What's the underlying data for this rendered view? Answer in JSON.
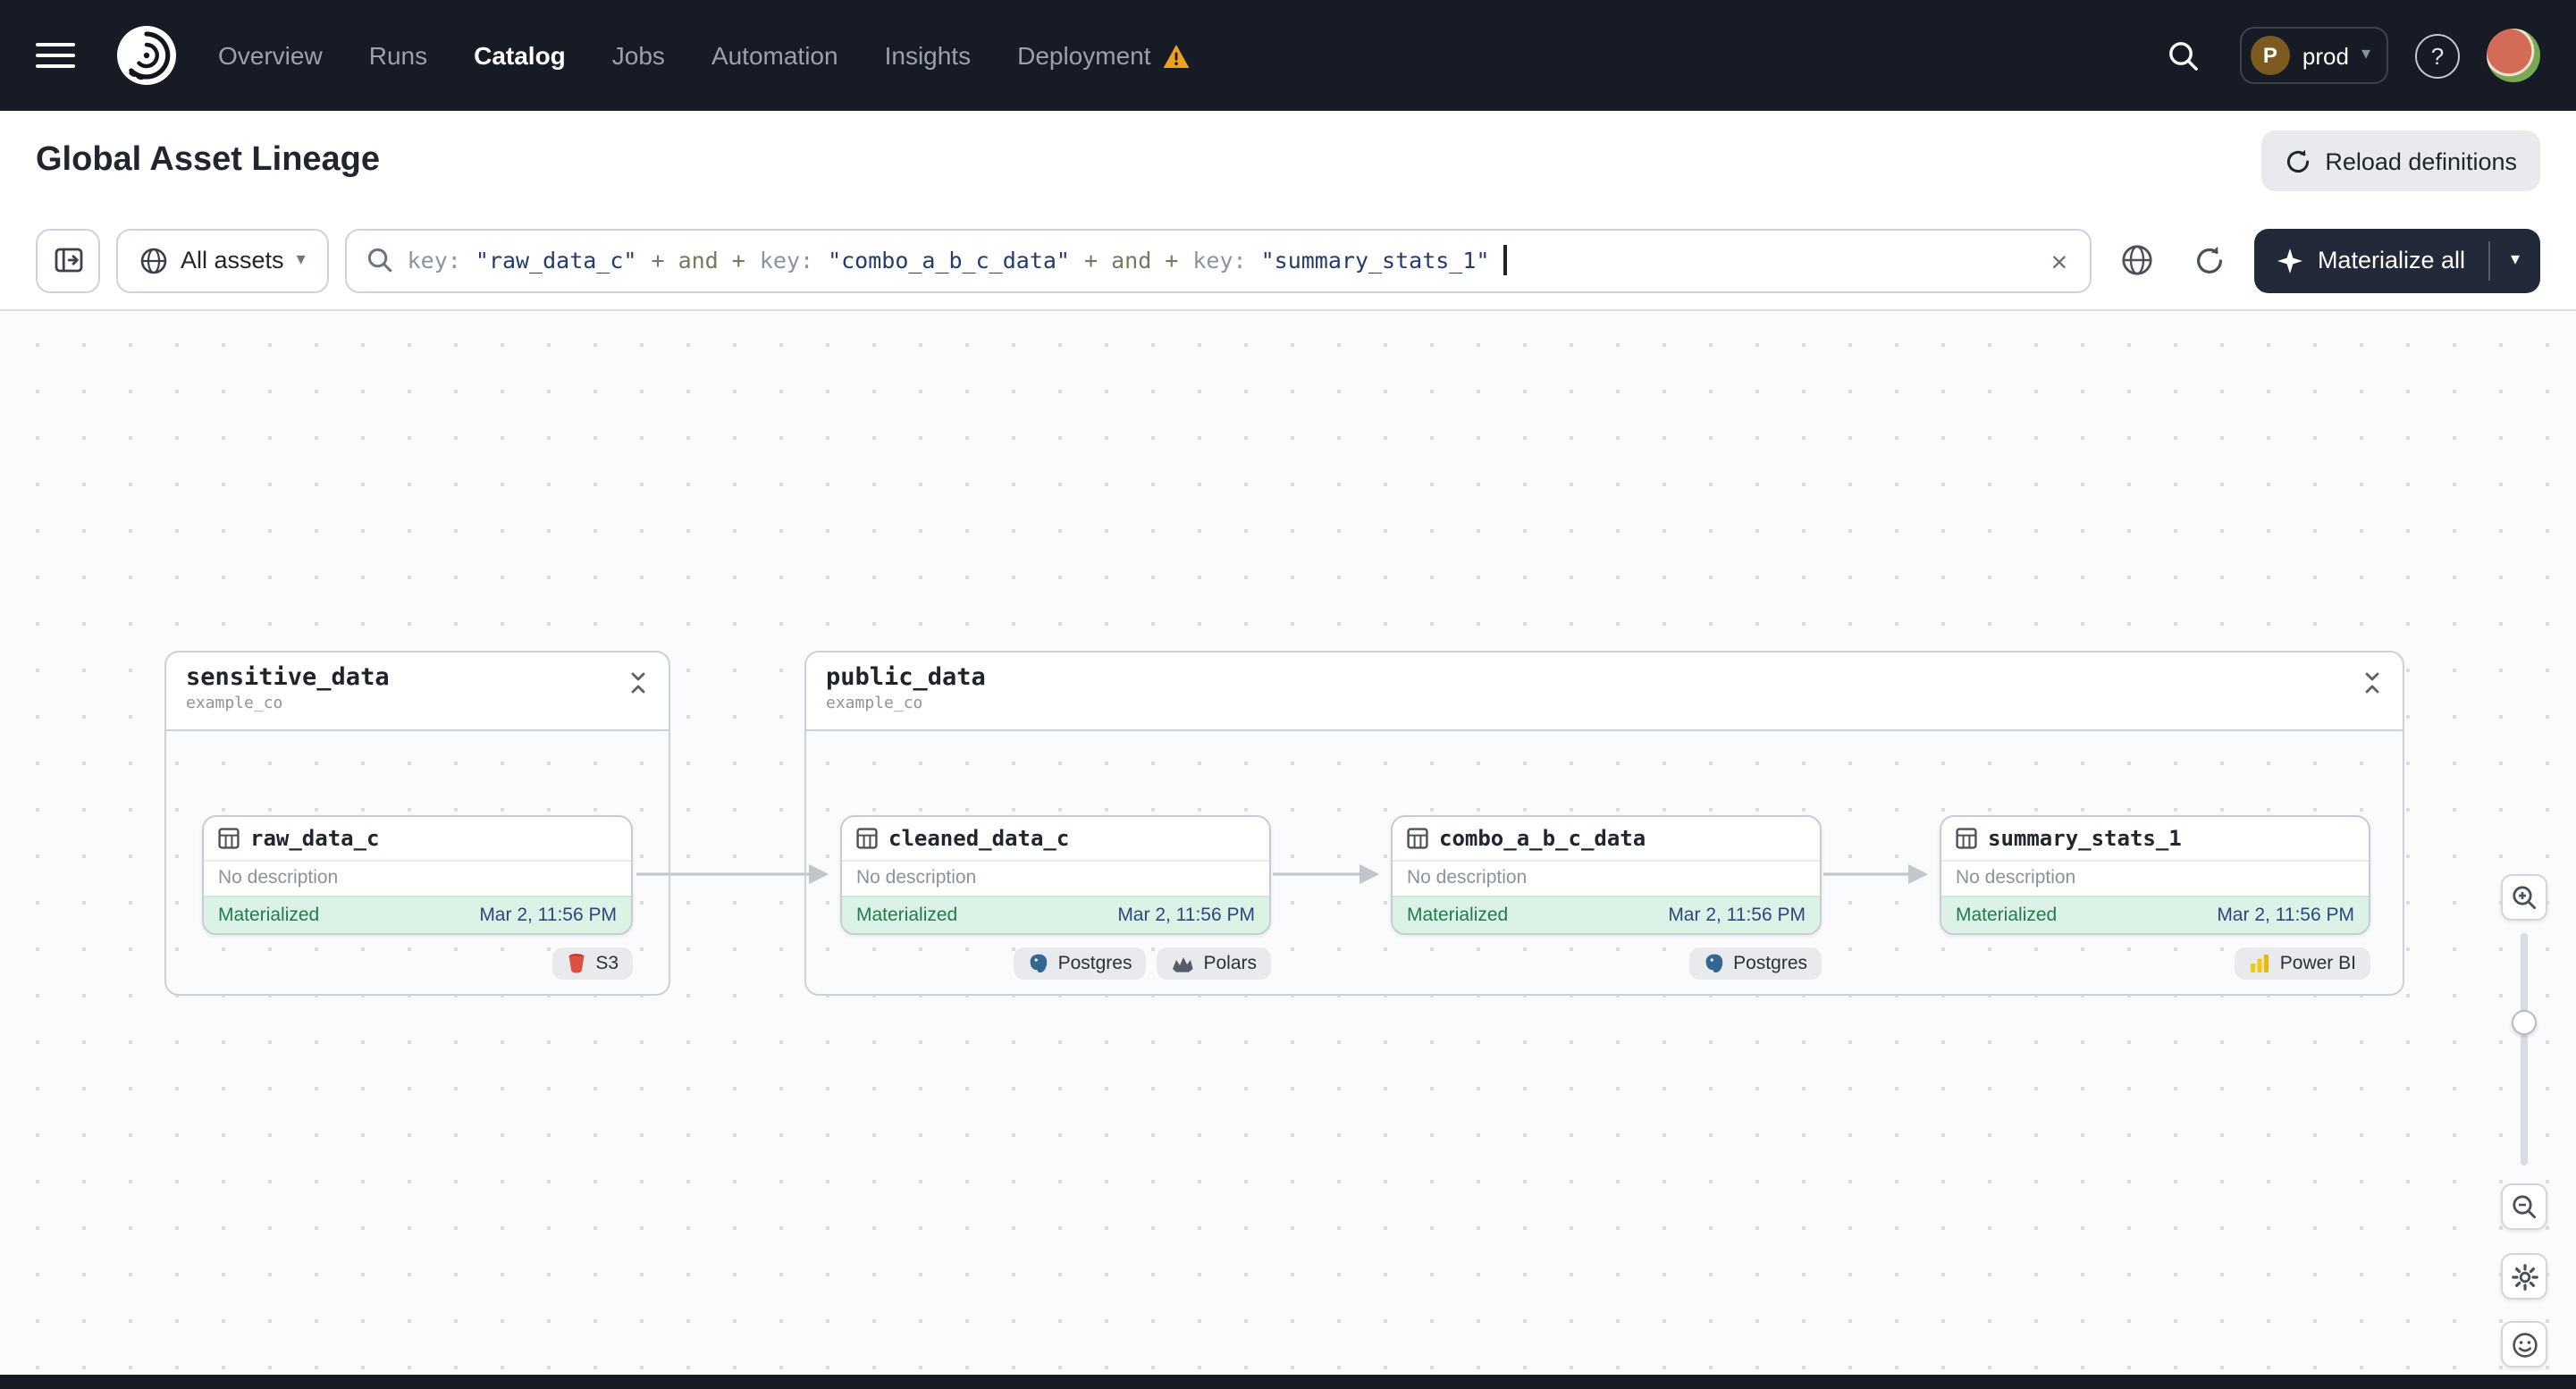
{
  "nav": {
    "items": [
      {
        "label": "Overview"
      },
      {
        "label": "Runs"
      },
      {
        "label": "Catalog"
      },
      {
        "label": "Jobs"
      },
      {
        "label": "Automation"
      },
      {
        "label": "Insights"
      },
      {
        "label": "Deployment"
      }
    ],
    "active_item": "Catalog",
    "prod": {
      "initial": "P",
      "label": "prod"
    },
    "help_label": "?"
  },
  "header": {
    "title": "Global Asset Lineage",
    "reload_label": "Reload definitions"
  },
  "toolbar": {
    "scope_label": "All assets",
    "query": [
      {
        "text": "key:"
      },
      {
        "text": "\"raw_data_c\""
      },
      {
        "text": "+ and +"
      },
      {
        "text": "key:"
      },
      {
        "text": "\"combo_a_b_c_data\""
      },
      {
        "text": "+ and +"
      },
      {
        "text": "key:"
      },
      {
        "text": "\"summary_stats_1\""
      }
    ],
    "clear_label": "✕",
    "materialize_label": "Materialize all"
  },
  "graph": {
    "groups": [
      {
        "name": "sensitive_data",
        "location": "example_co",
        "assets": [
          {
            "name": "raw_data_c",
            "description": "No description",
            "status": "Materialized",
            "timestamp": "Mar 2, 11:56 PM",
            "tags": [
              {
                "label": "S3"
              }
            ]
          }
        ]
      },
      {
        "name": "public_data",
        "location": "example_co",
        "assets": [
          {
            "name": "cleaned_data_c",
            "description": "No description",
            "status": "Materialized",
            "timestamp": "Mar 2, 11:56 PM",
            "tags": [
              {
                "label": "Postgres"
              },
              {
                "label": "Polars"
              }
            ]
          },
          {
            "name": "combo_a_b_c_data",
            "description": "No description",
            "status": "Materialized",
            "timestamp": "Mar 2, 11:56 PM",
            "tags": [
              {
                "label": "Postgres"
              }
            ]
          },
          {
            "name": "summary_stats_1",
            "description": "No description",
            "status": "Materialized",
            "timestamp": "Mar 2, 11:56 PM",
            "tags": [
              {
                "label": "Power BI"
              }
            ]
          }
        ]
      }
    ]
  },
  "colors": {
    "nav_bg": "#171b26",
    "status_green_bg": "#ddf2e6",
    "status_green_text": "#1e7c4e",
    "timestamp_blue": "#2b477c",
    "warning_orange": "#f0a11b",
    "materialize_bg": "#222a39",
    "query_value": "#223c6e",
    "query_operator": "#6f7d5e"
  }
}
